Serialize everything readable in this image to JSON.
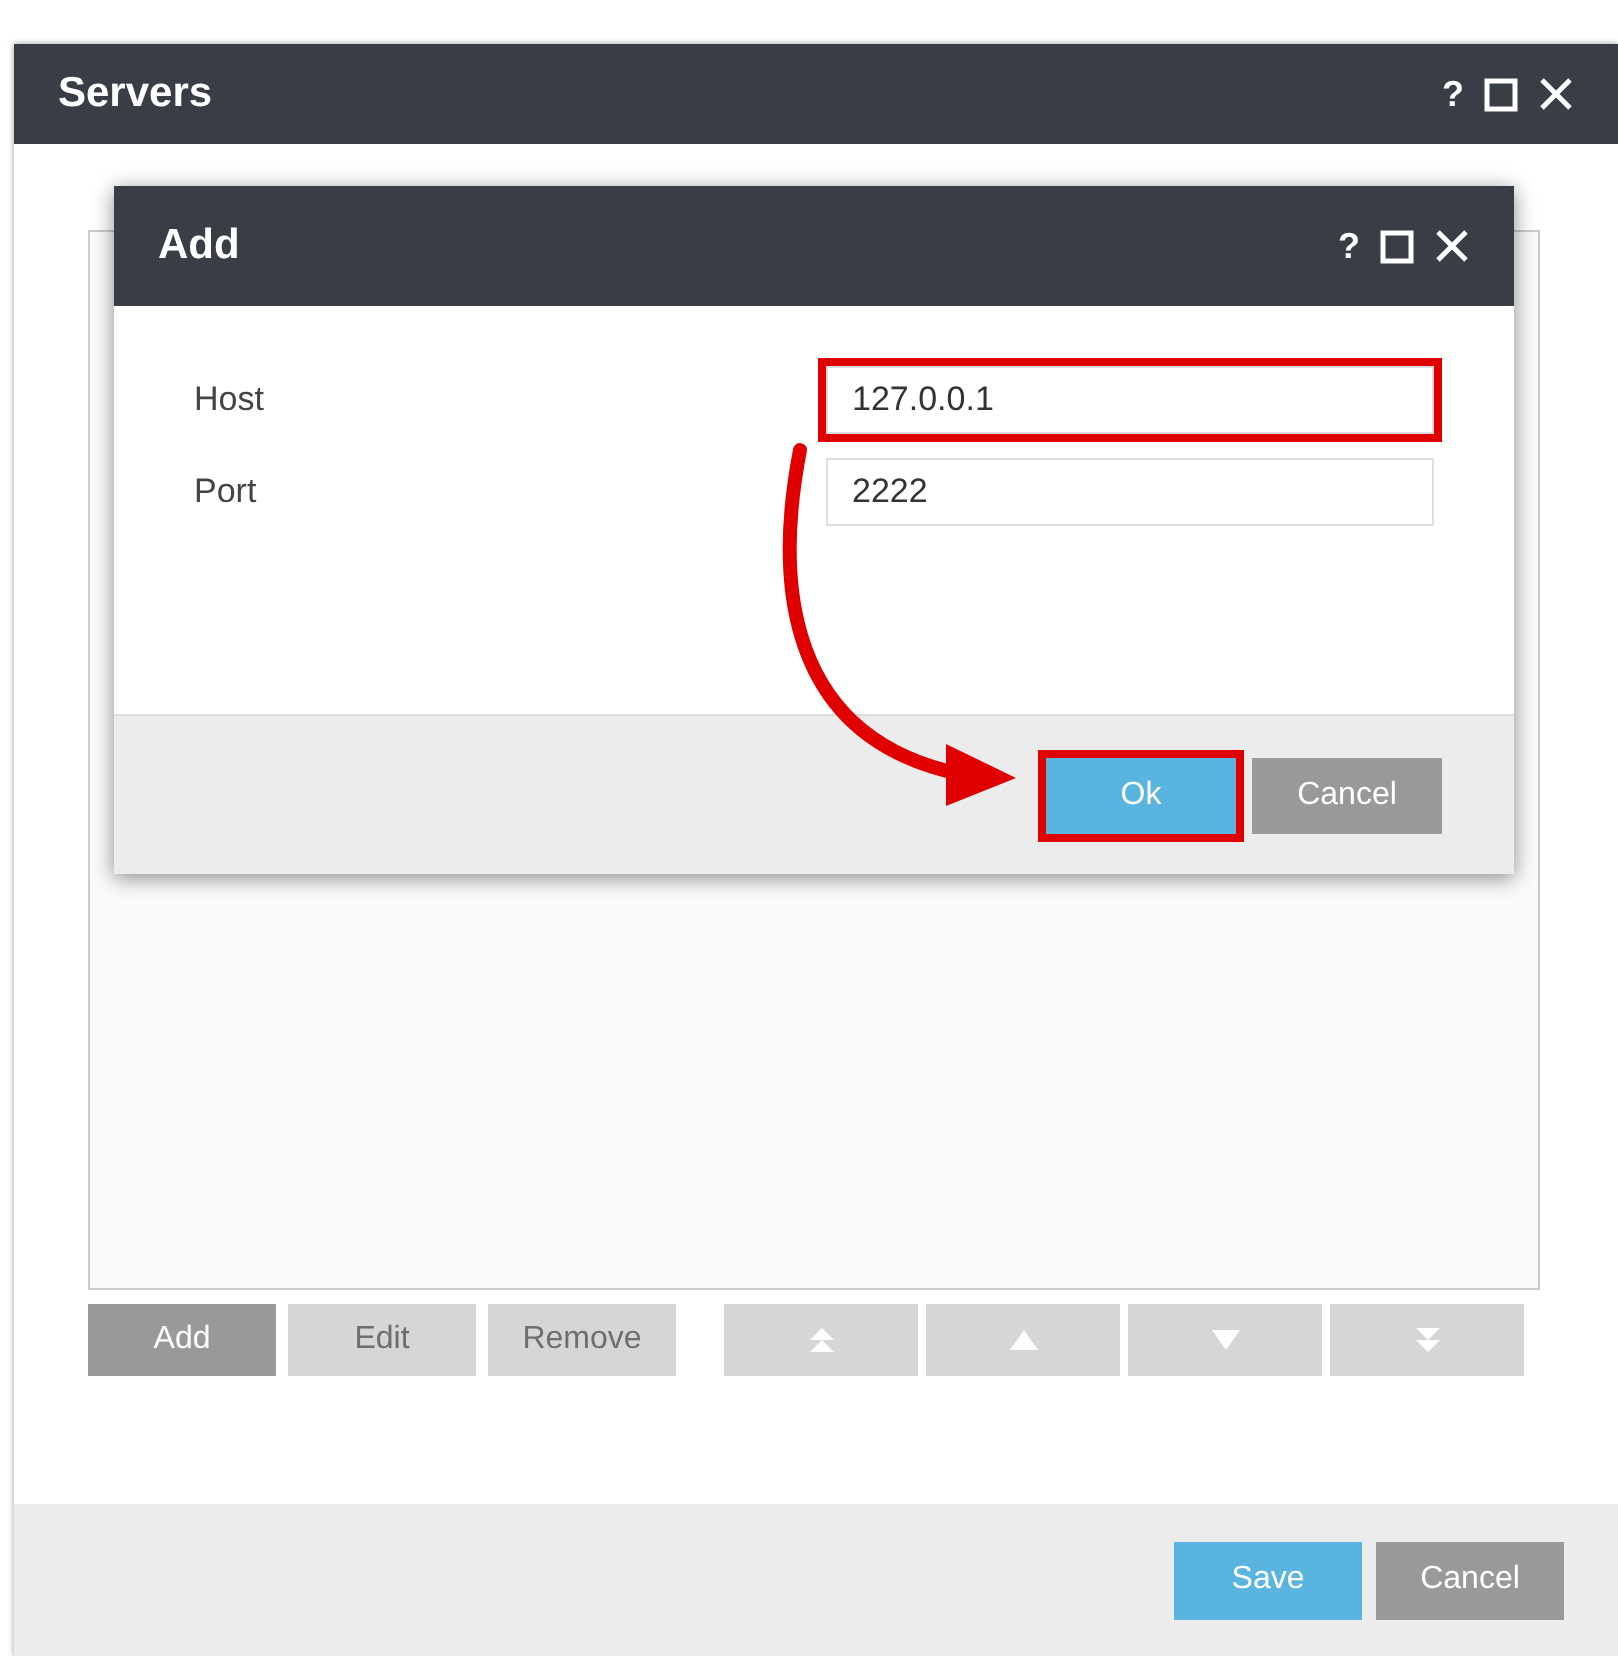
{
  "window": {
    "title": "Servers",
    "help": "?"
  },
  "list_buttons": [
    {
      "label": "Add",
      "disabled": false
    },
    {
      "label": "Edit",
      "disabled": true
    },
    {
      "label": "Remove",
      "disabled": true
    }
  ],
  "move_buttons": [
    {
      "kind": "top",
      "disabled": true
    },
    {
      "kind": "up",
      "disabled": true
    },
    {
      "kind": "down",
      "disabled": true
    },
    {
      "kind": "bottom",
      "disabled": true
    }
  ],
  "footer_buttons": [
    {
      "label": "Save",
      "kind": "primary"
    },
    {
      "label": "Cancel",
      "kind": "secondary"
    }
  ],
  "dialog": {
    "title": "Add",
    "help": "?",
    "fields": [
      {
        "label": "Host",
        "value": "127.0.0.1",
        "highlighted": true
      },
      {
        "label": "Port",
        "value": "2222",
        "highlighted": false
      }
    ],
    "buttons": [
      {
        "label": "Ok",
        "kind": "primary",
        "highlighted": true
      },
      {
        "label": "Cancel",
        "kind": "secondary",
        "highlighted": false
      }
    ]
  }
}
